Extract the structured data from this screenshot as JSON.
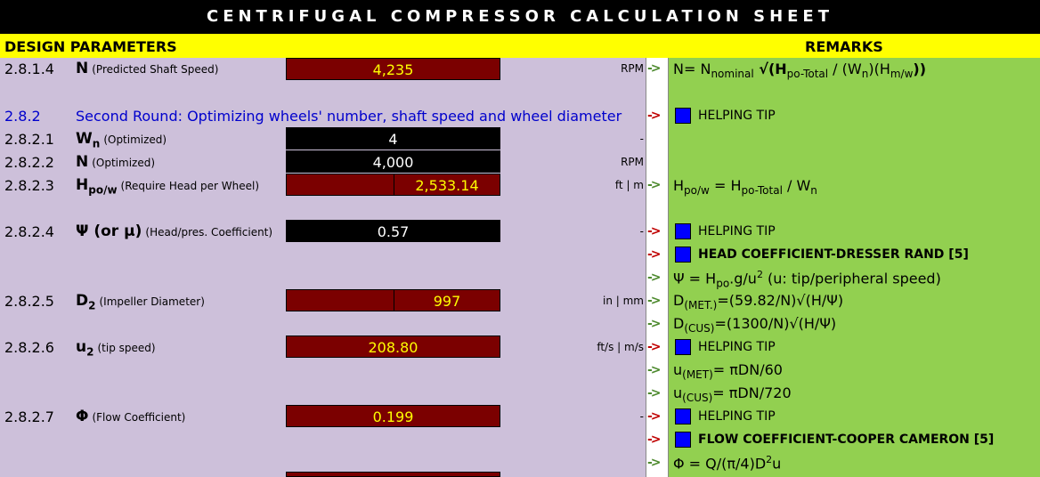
{
  "title": "CENTRIFUGAL COMPRESSOR CALCULATION SHEET",
  "header": {
    "left": "DESIGN PARAMETERS",
    "right": "REMARKS"
  },
  "arrow": "->",
  "rows": [
    {
      "num": "2.8.1.4",
      "sym": "N",
      "desc": "(Predicted Shaft Speed)",
      "value": "4,235",
      "unit": "RPM"
    },
    {
      "num": "2.8.2",
      "title": "Second Round: Optimizing wheels' number, shaft speed and wheel diameter"
    },
    {
      "num": "2.8.2.1",
      "sym": "W",
      "sub": "n",
      "desc": "(Optimized)",
      "value": "4",
      "unit": "-"
    },
    {
      "num": "2.8.2.2",
      "sym": "N",
      "desc": "(Optimized)",
      "value": "4,000",
      "unit": "RPM"
    },
    {
      "num": "2.8.2.3",
      "sym": "H",
      "sub": "po/w",
      "desc": "(Require Head per Wheel)",
      "value": "2,533.14",
      "unit": "ft | m"
    },
    {
      "num": "2.8.2.4",
      "sym": "Ψ (or μ)",
      "desc": "(Head/pres. Coefficient)",
      "value": "0.57",
      "unit": "-"
    },
    {
      "num": "2.8.2.5",
      "sym": "D",
      "sub": "2",
      "desc": "(Impeller Diameter)",
      "value": "997",
      "unit": "in | mm"
    },
    {
      "num": "2.8.2.6",
      "sym": "u",
      "sub": "2",
      "desc": "(tip speed)",
      "value": "208.80",
      "unit": "ft/s | m/s"
    },
    {
      "num": "2.8.2.7",
      "sym": "Φ",
      "desc": "(Flow Coefficient)",
      "value": "0.199",
      "unit": "-"
    }
  ],
  "remarks": {
    "r1": {
      "a": "N= N",
      "b": "nominal",
      "c": " √(H",
      "d": "po-Total",
      "e": " / (W",
      "f": "n",
      "g": ")(H",
      "h": "m/w",
      "i": "))"
    },
    "helping_tip": "HELPING TIP",
    "r_hpo": {
      "a": "H",
      "b": "po/w",
      "c": " = H",
      "d": "po-Total",
      "e": " / W",
      "f": "n"
    },
    "head_coef": "HEAD COEFFICIENT-DRESSER RAND [5]",
    "r_psi": {
      "a": "Ψ = H",
      "b": "po",
      "c": ".g/u",
      "d": "2",
      "e": "  (u: tip/peripheral speed)"
    },
    "r_dmet": {
      "a": "D",
      "b": "(MET.)",
      "c": "=(59.82/N)√(H/Ψ)"
    },
    "r_dcus": {
      "a": "D",
      "b": "(CUS)",
      "c": "=(1300/N)√(H/Ψ)"
    },
    "r_umet": {
      "a": "u",
      "b": "(MET)",
      "c": "= πDN/60"
    },
    "r_ucus": {
      "a": "u",
      "b": "(CUS)",
      "c": "= πDN/720"
    },
    "flow_coef": "FLOW COEFFICIENT-COOPER CAMERON [5]",
    "r_phi": {
      "a": "Φ = Q/(π/4)D",
      "b": "2",
      "c": "u"
    }
  },
  "colors": {
    "title_bg": "#000000",
    "header_bg": "#ffff00",
    "left_bg": "#cdc0da",
    "right_bg": "#92d050",
    "value_red": "#7b0000",
    "value_yellow_text": "#ffff00",
    "blue_text": "#0000cc",
    "arrow_green": "#4d8a2e",
    "arrow_red": "#c00000"
  }
}
